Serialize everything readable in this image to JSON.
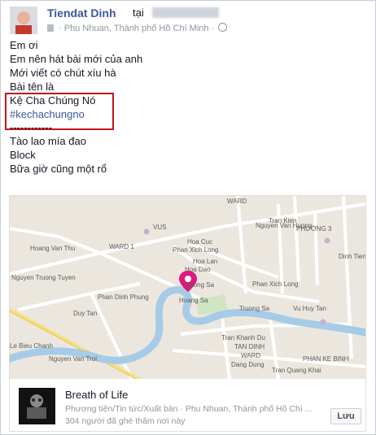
{
  "post": {
    "author": "Tiendat Dinh",
    "at_word": "tại",
    "location": "Phu Nhuan, Thành phố Hồ Chí Minh",
    "lines": [
      "Em ơi",
      "Em nên hát bài mới của anh",
      "Mới viết có chút xíu hà",
      "Bài tên là",
      "Kệ Cha Chúng Nó",
      "#kechachungno",
      "------------",
      "Tào lao mía đao",
      "Block",
      "Bữa giờ cũng một rổ"
    ]
  },
  "map": {
    "labels": [
      "Hoang Van Thu",
      "WARD 1",
      "WARD",
      "VUS",
      "Hoa Cuc",
      "Phan Xich Long",
      "Phan Xich Long",
      "Hoa Lan",
      "Hoa Dao",
      "Truong Sa",
      "Nguyen Truong Tuyen",
      "Phan Dinh Phung",
      "Duy Tan",
      "Hoang Sa",
      "Truong Sa",
      "Vu Huy Tan",
      "Tran Khanh Du",
      "TAN DINH",
      "WARD",
      "Dang Dung",
      "Nguyen Van Troi",
      "Le Bieu Chanh",
      "Tran Quang Khai",
      "PHAN KE BINH",
      "PHƯỜNG 3",
      "Dinh Tien Hoang",
      "Tran Kien",
      "Nguyen Van Huong"
    ]
  },
  "card": {
    "title": "Breath of Life",
    "category": "Phương tiện/Tin tức/Xuất bản",
    "location": "Phu Nhuan, Thành phố Hồ Chí ...",
    "visits": "304 người đã ghé thăm nơi này",
    "save_label": "Lưu"
  },
  "colors": {
    "brand": "#3b5998",
    "highlight": "#c0161b",
    "river": "#a6cbe6",
    "pin": "#e0187d"
  }
}
